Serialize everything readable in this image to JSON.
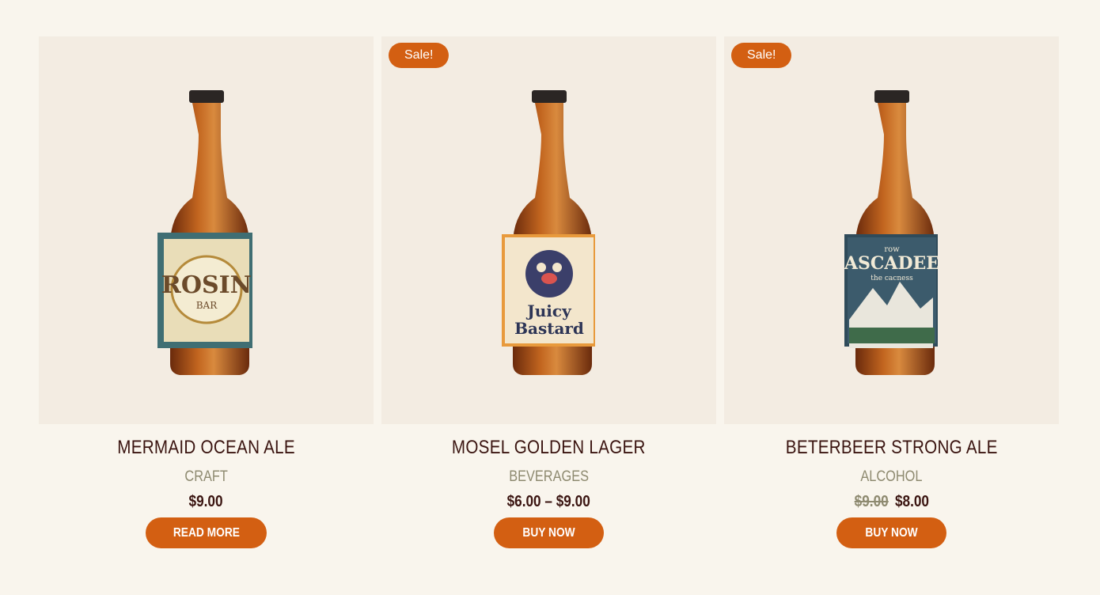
{
  "products": [
    {
      "title": "MERMAID OCEAN ALE",
      "category": "CRAFT",
      "price": "$9.00",
      "button": "READ MORE",
      "label": {
        "line1": "ROSIN",
        "line2": "BAR",
        "bg": "#e9ddb8",
        "border": "#3f6e73",
        "ink": "#6b4a2a"
      }
    },
    {
      "sale": "Sale!",
      "title": "MOSEL GOLDEN LAGER",
      "category": "BEVERAGES",
      "price": "$6.00 – $9.00",
      "button": "BUY NOW",
      "label": {
        "line1": "Juicy",
        "line2": "Bastard",
        "bg": "#f3e6cc",
        "border": "#e89a3c",
        "ink": "#2d3556"
      }
    },
    {
      "sale": "Sale!",
      "title": "BETERBEER STRONG ALE",
      "category": "ALCOHOL",
      "old_price": "$9.00",
      "price": "$8.00",
      "button": "BUY NOW",
      "label": {
        "line0": "row",
        "line1": "ASCADEE",
        "line2": "the cacness",
        "bg": "#3c5b6c",
        "border": "#2f4b5a",
        "ink": "#f1ead6"
      }
    }
  ],
  "colors": {
    "accent": "#d35f12",
    "title": "#3a1410",
    "category": "#8e8a70",
    "card_bg": "#f3ece2",
    "page_bg": "#f9f5ed"
  }
}
